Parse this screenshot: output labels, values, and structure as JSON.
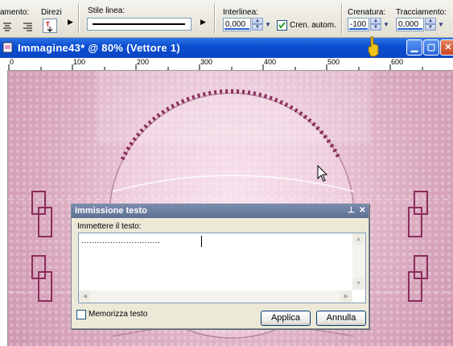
{
  "toolbar": {
    "alignment_label": "amento:",
    "direction_label": "Direzi",
    "line_style_label": "Stile linea:",
    "leading_label": "Interlinea:",
    "leading_value": "0,000",
    "auto_kern_label": "Cren. autom.",
    "auto_kern_checked": true,
    "kerning_label": "Crenatura:",
    "kerning_value": "-100",
    "tracking_label": "Tracciamento:",
    "tracking_value": "0,000"
  },
  "window": {
    "title": "Immagine43*  @  80% (Vettore 1)",
    "minimize_icon": "minimize-icon",
    "maximize_icon": "maximize-icon",
    "close_icon": "close-icon"
  },
  "ruler": {
    "ticks": [
      "0",
      "100",
      "200",
      "300",
      "400",
      "500",
      "600"
    ]
  },
  "dialog": {
    "title": "Immissione testo",
    "prompt": "Immettere il testo:",
    "text_value": "..............................",
    "remember_label": "Memorizza testo",
    "remember_checked": false,
    "apply_label": "Applica",
    "cancel_label": "Annulla"
  },
  "colors": {
    "titlebar": "#0a46c4",
    "canvas_pink": "#d8a4bb",
    "frame_pink": "#8a2d5c"
  }
}
